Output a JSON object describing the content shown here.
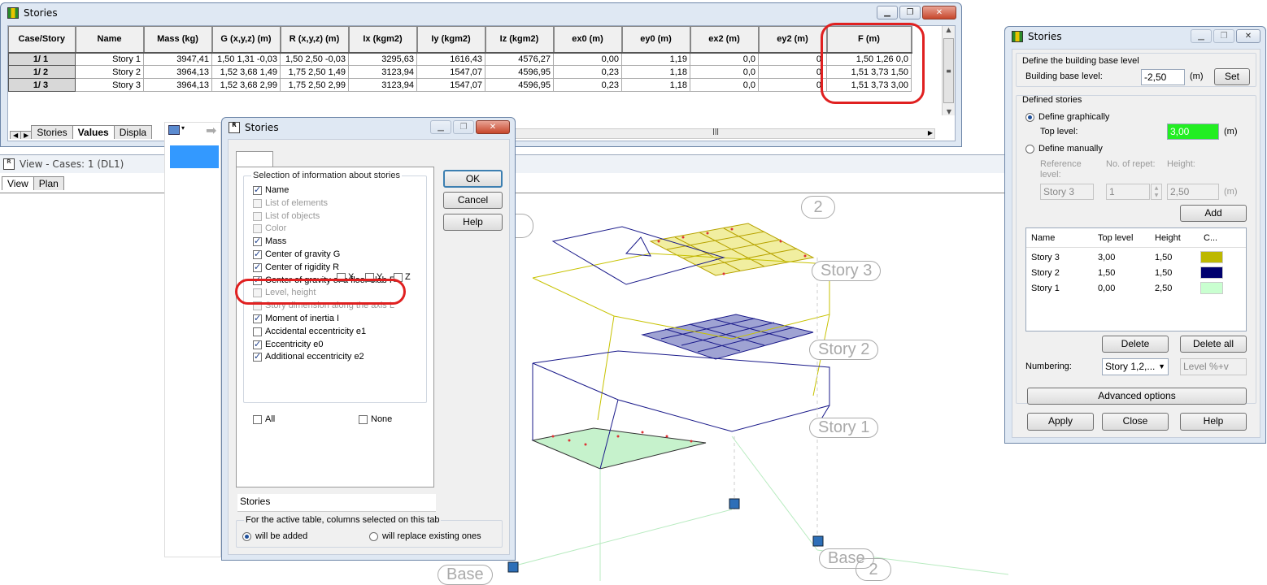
{
  "table_window": {
    "title": "Stories",
    "columns": [
      "Case/Story",
      "Name",
      "Mass (kg)",
      "G (x,y,z) (m)",
      "R (x,y,z) (m)",
      "Ix (kgm2)",
      "Iy (kgm2)",
      "Iz (kgm2)",
      "ex0 (m)",
      "ey0 (m)",
      "ex2 (m)",
      "ey2 (m)",
      "F (m)"
    ],
    "rows": [
      [
        "1/      1",
        "Story 1",
        "3947,41",
        "1,50 1,31 -0,03",
        "1,50 2,50 -0,03",
        "3295,63",
        "1616,43",
        "4576,27",
        "0,00",
        "1,19",
        "0,0",
        "0,",
        "1,50 1,26      0,0"
      ],
      [
        "1/      2",
        "Story 2",
        "3964,13",
        "1,52 3,68 1,49",
        "1,75 2,50 1,49",
        "3123,94",
        "1547,07",
        "4596,95",
        "0,23",
        "1,18",
        "0,0",
        "0,",
        "1,51 3,73 1,50"
      ],
      [
        "1/      3",
        "Story 3",
        "3964,13",
        "1,52 3,68 2,99",
        "1,75 2,50 2,99",
        "3123,94",
        "1547,07",
        "4596,95",
        "0,23",
        "1,18",
        "0,0",
        "0,",
        "1,51 3,73 3,00"
      ]
    ],
    "tabs": [
      "Stories",
      "Values",
      "Displa"
    ]
  },
  "view_window": {
    "title": "View - Cases: 1 (DL1)",
    "tabs": [
      "View",
      "Plan"
    ],
    "story_labels": [
      "Story 3",
      "Story 2",
      "Story 1",
      "Base"
    ],
    "axis_labels": [
      "2",
      "2",
      "2"
    ],
    "colors": {
      "story3": "#c7c200",
      "story2": "#1a1a8a",
      "story1": "#b8f3c0"
    }
  },
  "dialog": {
    "title": "Stories",
    "group_title": "Selection of information about stories",
    "options": [
      {
        "label": "Name",
        "checked": true,
        "enabled": true
      },
      {
        "label": "List of elements",
        "checked": false,
        "enabled": false
      },
      {
        "label": "List of objects",
        "checked": false,
        "enabled": false
      },
      {
        "label": "Color",
        "checked": false,
        "enabled": false
      },
      {
        "label": "Mass",
        "checked": true,
        "enabled": true
      },
      {
        "label": "Center of gravity G",
        "checked": true,
        "enabled": true
      },
      {
        "label": "Center of rigidity R",
        "checked": true,
        "enabled": true
      },
      {
        "label": "Center of gravity of a floor slab F",
        "checked": true,
        "enabled": true
      },
      {
        "label": "Level, height",
        "checked": false,
        "enabled": false
      },
      {
        "label": "Story dimension along the axis L",
        "checked": false,
        "enabled": false
      },
      {
        "label": "Moment of inertia I",
        "checked": true,
        "enabled": true
      },
      {
        "label": "Accidental eccentricity e1",
        "checked": false,
        "enabled": true
      },
      {
        "label": "Eccentricity e0",
        "checked": true,
        "enabled": true
      },
      {
        "label": "Additional eccentricity e2",
        "checked": true,
        "enabled": true
      }
    ],
    "xyz": [
      "X",
      "Y",
      "Z"
    ],
    "all_label": "All",
    "none_label": "None",
    "ok": "OK",
    "cancel": "Cancel",
    "help": "Help",
    "tab_name_value": "Stories",
    "footer_title": "For the active table, columns selected on this tab",
    "radio_added": "will be added",
    "radio_replace": "will replace existing ones"
  },
  "right_dialog": {
    "title": "Stories",
    "base_group": "Define the building base level",
    "base_label": "Building base level:",
    "base_value": "-2,50",
    "unit_m": "(m)",
    "set": "Set",
    "defined_group": "Defined stories",
    "define_graphically": "Define graphically",
    "top_level_label": "Top level:",
    "top_level_value": "3,00",
    "define_manually": "Define manually",
    "ref_level_label": "Reference level:",
    "no_repet_label": "No. of repet:",
    "height_label": "Height:",
    "ref_value": "Story 3",
    "repet_value": "1",
    "height_value": "2,50",
    "add": "Add",
    "list_columns": [
      "Name",
      "Top level",
      "Height",
      "C..."
    ],
    "list_rows": [
      {
        "name": "Story 3",
        "top": "3,00",
        "height": "1,50",
        "color": "#bdb800"
      },
      {
        "name": "Story 2",
        "top": "1,50",
        "height": "1,50",
        "color": "#00006e"
      },
      {
        "name": "Story 1",
        "top": "0,00",
        "height": "2,50",
        "color": "#c9ffd0"
      }
    ],
    "delete": "Delete",
    "delete_all": "Delete all",
    "numbering_label": "Numbering:",
    "numbering_value": "Story 1,2,...",
    "level_placeholder": "Level %+v",
    "advanced": "Advanced options",
    "apply": "Apply",
    "close": "Close",
    "help": "Help"
  }
}
